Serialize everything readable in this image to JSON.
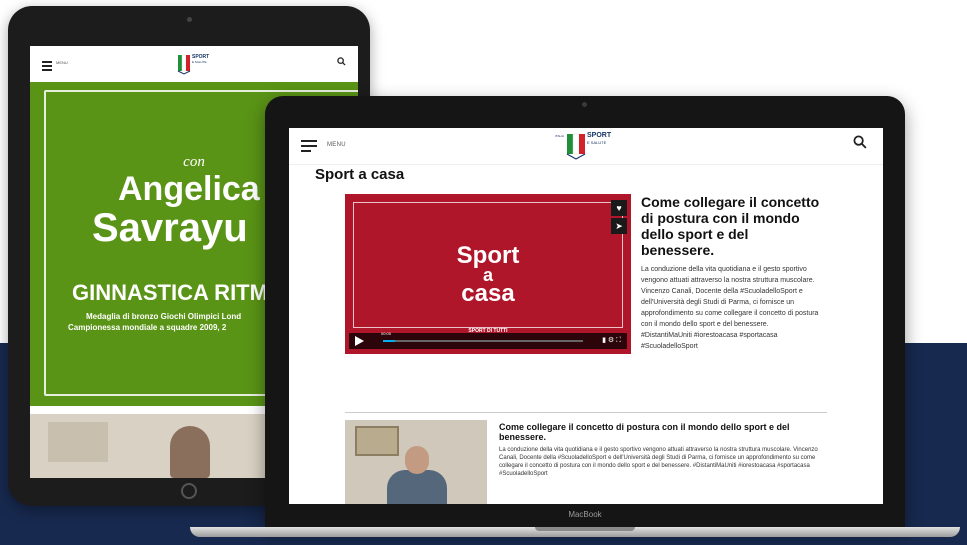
{
  "colors": {
    "navy_band": "#17294f",
    "hero_green": "#5a9416",
    "video_red": "#b0162a"
  },
  "tablet": {
    "header": {
      "menu_label": "MENU",
      "logo_text": "SPORT",
      "logo_sub": "E SALUTE",
      "search_icon": "search-icon"
    },
    "hero": {
      "con": "con",
      "name_line1": "Angelica",
      "name_line2": "Savrayu",
      "discipline": "GINNASTICA RITM",
      "medal": "Medaglia di bronzo Giochi Olimpici Lond",
      "championship": "Campionessa mondiale a squadre 2009, 2"
    }
  },
  "laptop": {
    "brand": "MacBook",
    "header": {
      "menu_label": "MENU",
      "logo_text": "SPORT",
      "logo_sub": "E SALUTE",
      "logo_side": "ITALIA",
      "search_icon": "search-icon"
    },
    "page_title": "Sport a casa",
    "video": {
      "title_lines": [
        "Sport",
        "a",
        "casa"
      ],
      "subtitle": "SPORT DI TUTTI",
      "time": "00:05",
      "progress": 0.06
    },
    "featured": {
      "title": "Come collegare il concetto di postura con il mondo dello sport e del benessere.",
      "text": "La conduzione della vita quotidiana e il gesto sportivo vengono attuati attraverso la nostra struttura muscolare. Vincenzo Canali, Docente della #ScuoladelloSport e dell'Università degli Studi di Parma, ci fornisce un approfondimento su come collegare il concetto di postura con il mondo dello sport e del benessere. #DistantiMaUniti #iorestoacasa #sportacasa #ScuoladelloSport"
    },
    "list_item": {
      "title": "Come collegare il concetto di postura con il mondo dello sport e del benessere.",
      "text": "La conduzione della vita quotidiana e il gesto sportivo vengono attuati attraverso la nostra struttura muscolare. Vincenzo Canali, Docente della #ScuoladelloSport e dell'Università degli Studi di Parma, ci fornisce un approfondimento su come collegare il concetto di postura con il mondo dello sport e del benessere. #DistantiMaUniti #iorestoacasa #sportacasa #ScuoladelloSport"
    }
  }
}
